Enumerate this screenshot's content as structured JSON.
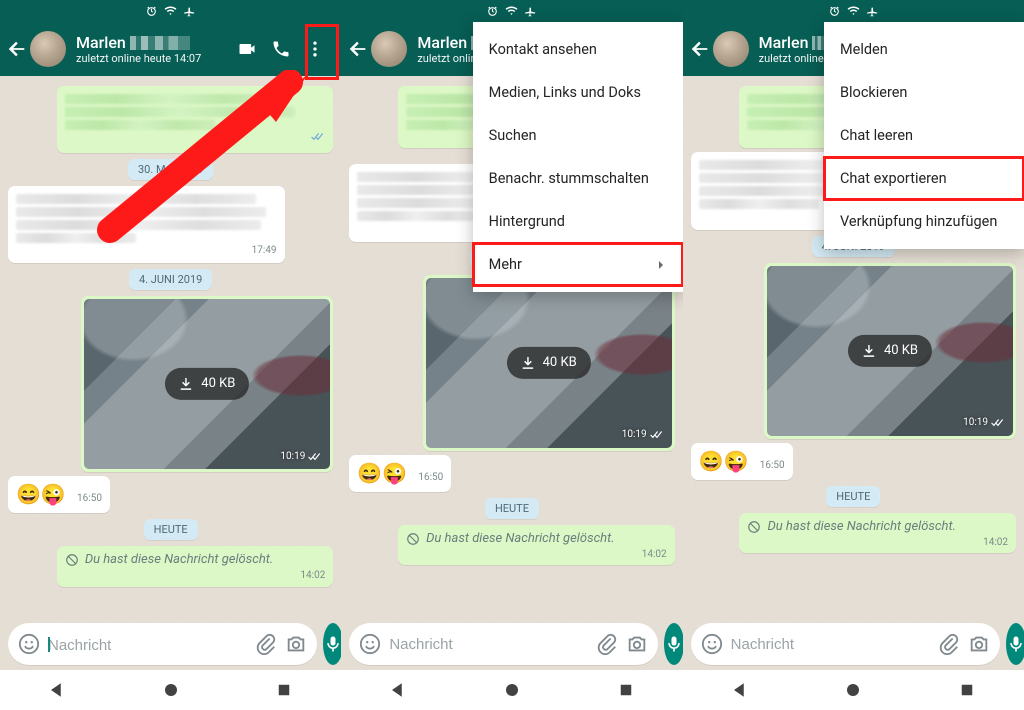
{
  "status": {
    "alarm": "⏰",
    "wifi": "wifi",
    "airplane": "✈"
  },
  "header": {
    "name": "Marlen",
    "sub_full": "zuletzt online heute 14:07",
    "sub_cut": "zuletzt online h",
    "sub_cut2": "zuletzt online"
  },
  "dates": {
    "d1": "30. MAI 2019",
    "d2": "4. JUNI 2019",
    "today": "HEUTE"
  },
  "times": {
    "t1": "17:49",
    "img": "10:19",
    "emoji": "16:50",
    "del": "14:02"
  },
  "download_label": "40 KB",
  "emoji_text": "😄😜",
  "deleted_text": "Du hast diese Nachricht gelöscht.",
  "input": {
    "placeholder": "Nachricht"
  },
  "menu1": {
    "items": [
      "Kontakt ansehen",
      "Medien, Links und Doks",
      "Suchen",
      "Benachr. stummschalten",
      "Hintergrund",
      "Mehr"
    ]
  },
  "menu2": {
    "items": [
      "Melden",
      "Blockieren",
      "Chat leeren",
      "Chat exportieren",
      "Verknüpfung hinzufügen"
    ]
  }
}
